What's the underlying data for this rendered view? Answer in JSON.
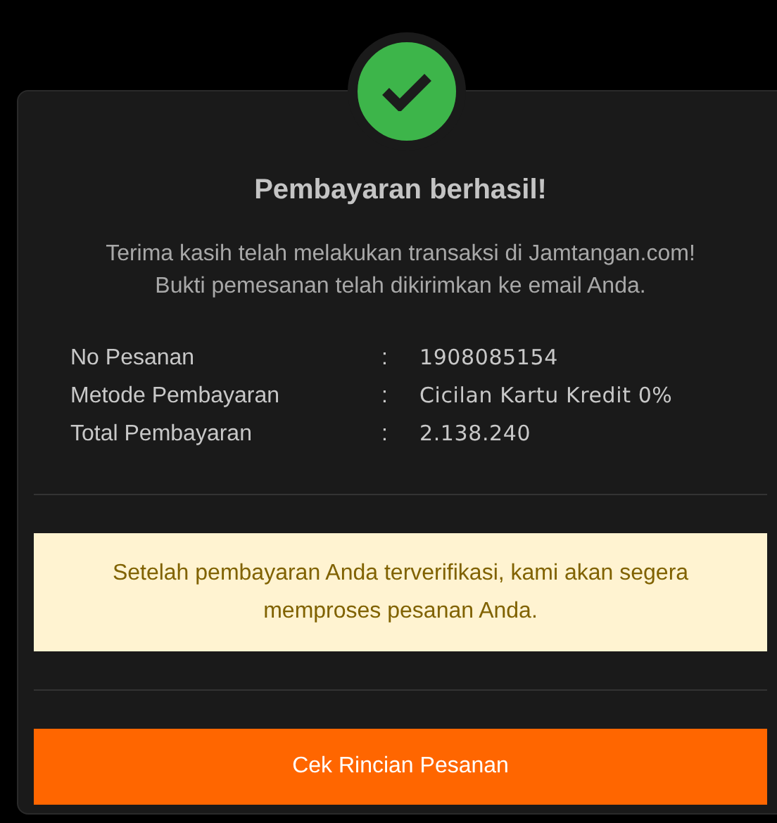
{
  "title": "Pembayaran berhasil!",
  "message": [
    "Terima kasih telah melakukan transaksi di Jamtangan.com!",
    "Bukti pemesanan telah dikirimkan ke email Anda."
  ],
  "details": [
    {
      "label": "No Pesanan",
      "separator": ":",
      "value": "1908085154"
    },
    {
      "label": "Metode Pembayaran",
      "separator": ":",
      "value": "Cicilan Kartu Kredit 0%"
    },
    {
      "label": "Total Pembayaran",
      "separator": ":",
      "value": "2.138.240"
    }
  ],
  "notice": "Setelah pembayaran Anda terverifikasi, kami akan segera memproses pesanan Anda.",
  "button": "Cek Rincian Pesanan"
}
